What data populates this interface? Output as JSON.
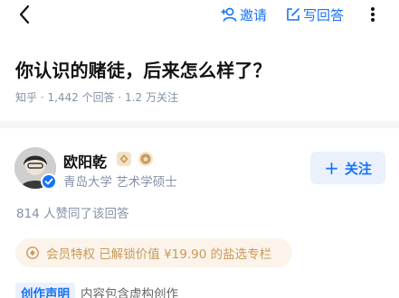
{
  "topbar": {
    "back_icon": "chevron-left-icon",
    "invite_label": "邀请",
    "write_label": "写回答",
    "more_icon": "more-vertical-icon",
    "accent_color": "#1772f6"
  },
  "question": {
    "title": "你认识的赌徒，后来怎么样了？",
    "meta": "知乎 · 1,442 个回答 · 1.2 万关注"
  },
  "author": {
    "name": "欧阳乾",
    "description": "青岛大学 艺术学硕士",
    "follow_label": "关注"
  },
  "answer": {
    "likes": "814 人赞同了该回答",
    "paid_banner": "会员特权 已解锁价值 ¥19.90 的盐选专栏",
    "declaration_label": "创作声明",
    "declaration_text": "内容包含虚构创作"
  }
}
